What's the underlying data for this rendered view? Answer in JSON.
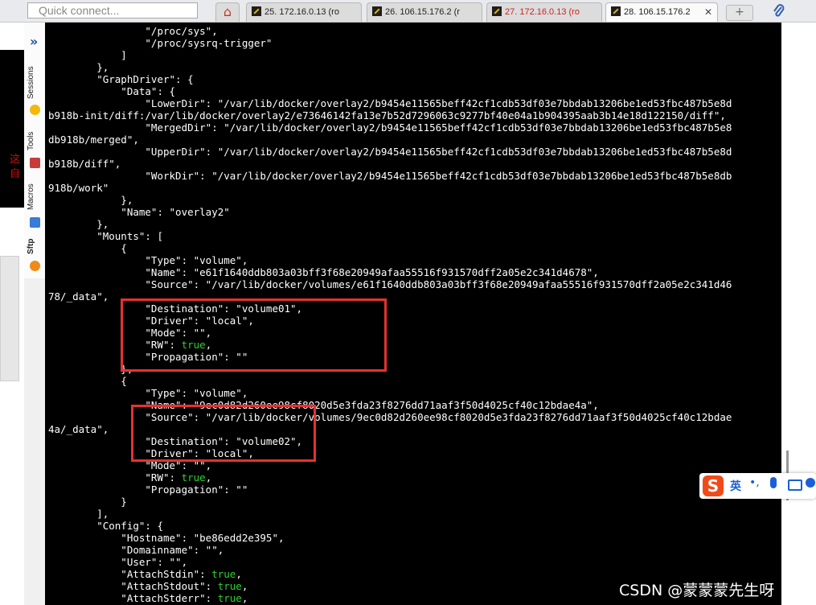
{
  "topbar": {
    "quick_connect_placeholder": "Quick connect...",
    "tabs": [
      {
        "label": "25. 172.16.0.13 (ro",
        "active": false,
        "color": "#222222"
      },
      {
        "label": "26. 106.15.176.2 (r",
        "active": false,
        "color": "#222222"
      },
      {
        "label": "27. 172.16.0.13 (ro",
        "active": false,
        "color": "#d42020"
      },
      {
        "label": "28. 106.15.176.2",
        "active": true,
        "color": "#222222"
      }
    ],
    "close_glyph": "✕",
    "new_tab_glyph": "+"
  },
  "sidebar": {
    "expand_glyph": "»",
    "items": [
      {
        "label": "Sessions",
        "icon": "star-icon"
      },
      {
        "label": "Tools",
        "icon": "wrench-icon"
      },
      {
        "label": "Macros",
        "icon": "paper-plane-icon"
      },
      {
        "label": "Sftp",
        "icon": "sftp-icon"
      }
    ]
  },
  "background": {
    "red_text_line1": "这",
    "red_text_line2": "自"
  },
  "terminal": {
    "lines": [
      "                \"/proc/sys\",",
      "                \"/proc/sysrq-trigger\"",
      "            ]",
      "        },",
      "        \"GraphDriver\": {",
      "            \"Data\": {",
      "                \"LowerDir\": \"/var/lib/docker/overlay2/b9454e11565beff42cf1cdb53df03e7bbdab13206be1ed53fbc487b5e8d",
      "b918b-init/diff:/var/lib/docker/overlay2/e73646142fa13e7b52d7296063c9277bf40e04a1b904395aab3b14e18d122150/diff\",",
      "                \"MergedDir\": \"/var/lib/docker/overlay2/b9454e11565beff42cf1cdb53df03e7bbdab13206be1ed53fbc487b5e8",
      "db918b/merged\",",
      "                \"UpperDir\": \"/var/lib/docker/overlay2/b9454e11565beff42cf1cdb53df03e7bbdab13206be1ed53fbc487b5e8d",
      "b918b/diff\",",
      "                \"WorkDir\": \"/var/lib/docker/overlay2/b9454e11565beff42cf1cdb53df03e7bbdab13206be1ed53fbc487b5e8db",
      "918b/work\"",
      "            },",
      "            \"Name\": \"overlay2\"",
      "        },",
      "        \"Mounts\": [",
      "            {",
      "                \"Type\": \"volume\",",
      "                \"Name\": \"e61f1640ddb803a03bff3f68e20949afaa55516f931570dff2a05e2c341d4678\",",
      "                \"Source\": \"/var/lib/docker/volumes/e61f1640ddb803a03bff3f68e20949afaa55516f931570dff2a05e2c341d46",
      "78/_data\",",
      "                \"Destination\": \"volume01\",",
      "                \"Driver\": \"local\",",
      "                \"Mode\": \"\",",
      "                \"RW\": |true|,",
      "                \"Propagation\": \"\"",
      "            },",
      "            {",
      "                \"Type\": \"volume\",",
      "                \"Name\": \"9ec0d82d260ee98cf8020d5e3fda23f8276dd71aaf3f50d4025cf40c12bdae4a\",",
      "                \"Source\": \"/var/lib/docker/volumes/9ec0d82d260ee98cf8020d5e3fda23f8276dd71aaf3f50d4025cf40c12bdae",
      "4a/_data\",",
      "                \"Destination\": \"volume02\",",
      "                \"Driver\": \"local\",",
      "                \"Mode\": \"\",",
      "                \"RW\": |true|,",
      "                \"Propagation\": \"\"",
      "            }",
      "        ],",
      "        \"Config\": {",
      "            \"Hostname\": \"be86edd2e395\",",
      "            \"Domainname\": \"\",",
      "            \"User\": \"\",",
      "            \"AttachStdin\": |true|,",
      "            \"AttachStdout\": |true|,",
      "            \"AttachStderr\": |true|,"
    ]
  },
  "ime": {
    "logo": "S",
    "lang": "英",
    "punct": "•,"
  },
  "watermark": "CSDN @蒙蒙蒙先生呀",
  "colors": {
    "highlight_box": "#e83030",
    "json_boolean": "#2fd12f",
    "terminal_bg": "#000000"
  }
}
